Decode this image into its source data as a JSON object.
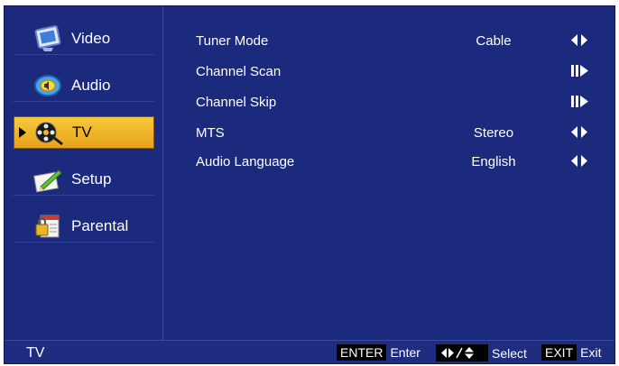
{
  "sidebar": {
    "items": [
      {
        "label": "Video",
        "icon": "video-monitor-icon",
        "active": false
      },
      {
        "label": "Audio",
        "icon": "audio-speaker-icon",
        "active": false
      },
      {
        "label": "TV",
        "icon": "tv-film-reel-icon",
        "active": true
      },
      {
        "label": "Setup",
        "icon": "setup-pencil-icon",
        "active": false
      },
      {
        "label": "Parental",
        "icon": "parental-lock-icon",
        "active": false
      }
    ]
  },
  "main": {
    "rows": [
      {
        "name": "Tuner Mode",
        "value": "Cable",
        "control": "left-right-arrows-icon"
      },
      {
        "name": "Channel Scan",
        "value": "",
        "control": "enter-submenu-icon"
      },
      {
        "name": "Channel Skip",
        "value": "",
        "control": "enter-submenu-icon"
      },
      {
        "name": "MTS",
        "value": "Stereo",
        "control": "left-right-arrows-icon"
      },
      {
        "name": "Audio Language",
        "value": "English",
        "control": "left-right-arrows-icon"
      }
    ]
  },
  "bottombar": {
    "title": "TV",
    "enter_key": "ENTER",
    "enter_label": "Enter",
    "select_label": "Select",
    "exit_key": "EXIT",
    "exit_label": "Exit"
  },
  "colors": {
    "background": "#1b2a7c",
    "highlight": "#f2b52a",
    "text": "#ffffff"
  }
}
